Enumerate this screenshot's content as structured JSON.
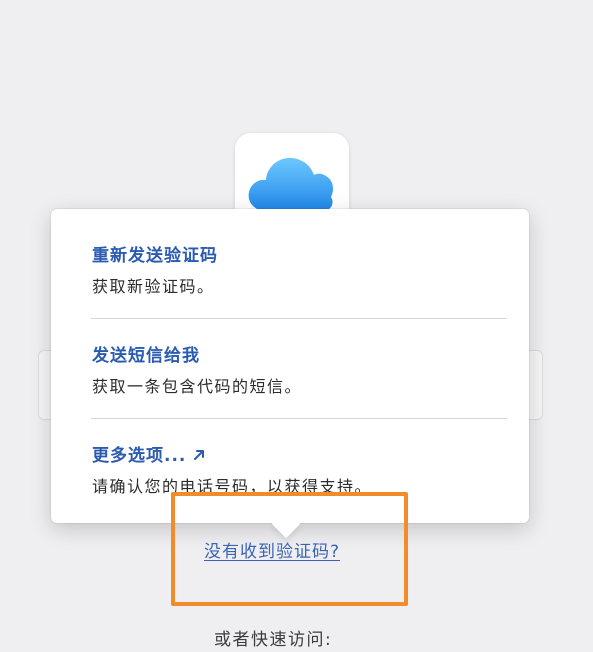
{
  "app_icon": {
    "name": "icloud-icon"
  },
  "popover": {
    "options": [
      {
        "title": "重新发送验证码",
        "description": "获取新验证码。"
      },
      {
        "title": "发送短信给我",
        "description": "获取一条包含代码的短信。"
      },
      {
        "title": "更多选项...",
        "description": "请确认您的电话号码，以获得支持。",
        "icon": "external-arrow-icon"
      }
    ]
  },
  "link": {
    "no_code": "没有收到验证码?"
  },
  "footer": {
    "quick_access": "或者快速访问:"
  },
  "colors": {
    "link": "#2a5bb0",
    "highlight": "#f28b2a",
    "background": "#efeff1"
  }
}
